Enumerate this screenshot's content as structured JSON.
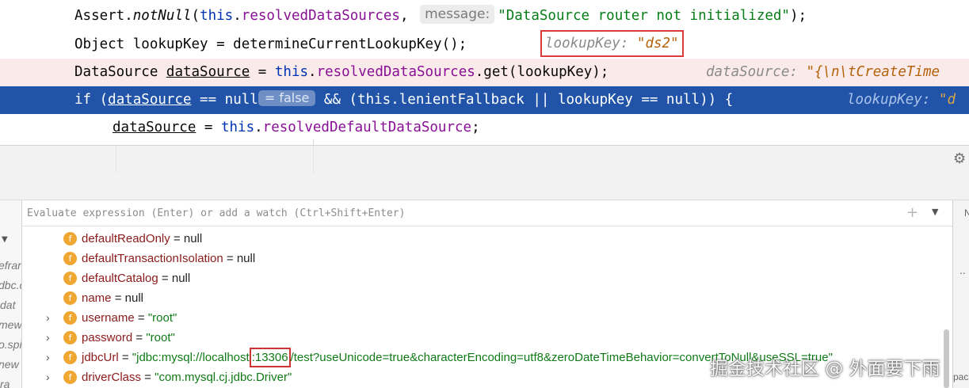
{
  "editor": {
    "line1": {
      "assert": "Assert.",
      "not_null": "notNull",
      "open": "(",
      "this_kw": "this",
      "dot": ".",
      "field": "resolvedDataSources",
      "comma": ",",
      "param_hint": "message:",
      "message": "\"DataSource router not initialized\"",
      "close": ");"
    },
    "line2": {
      "code": "Object lookupKey = determineCurrentLookupKey();",
      "inline_label": "lookupKey: ",
      "inline_value": "\"ds2\""
    },
    "line3": {
      "type": "DataSource ",
      "var": "dataSource",
      "eq": " = ",
      "this_kw": "this",
      "dot": ".",
      "field": "resolvedDataSources",
      "rest": ".get(lookupKey);",
      "inline_label": "dataSource: ",
      "inline_value": "\"{\\n\\tCreateTime"
    },
    "line4": {
      "if_kw": "if",
      "paren": " (",
      "var": "dataSource",
      "cond": " == null",
      "pill": "= false",
      "and": " && (",
      "this_kw": "this",
      "dot": ".",
      "field": "lenientFallback",
      "rest": " || lookupKey == null)) {",
      "inline_label": "lookupKey: ",
      "inline_value": "\"d"
    },
    "line5": {
      "var": "dataSource",
      "eq": " = ",
      "this_kw": "this",
      "dot": ".",
      "field": "resolvedDefaultDataSource",
      "end": ";"
    }
  },
  "watch": {
    "placeholder": "Evaluate expression (Enter) or add a watch (Ctrl+Shift+Enter)"
  },
  "frames": [
    "efran",
    "dbc.c",
    "dat",
    "mew",
    "o.spi",
    "new",
    "ra"
  ],
  "right_panel": {
    "label1": "N",
    "label2": "..",
    "label3": "pac"
  },
  "variables": [
    {
      "name": "defaultReadOnly",
      "eq": " = ",
      "value": "null",
      "is_string": false,
      "expandable": false
    },
    {
      "name": "defaultTransactionIsolation",
      "eq": " = ",
      "value": "null",
      "is_string": false,
      "expandable": false
    },
    {
      "name": "defaultCatalog",
      "eq": " = ",
      "value": "null",
      "is_string": false,
      "expandable": false
    },
    {
      "name": "name",
      "eq": " = ",
      "value": "null",
      "is_string": false,
      "expandable": false
    },
    {
      "name": "username",
      "eq": " = ",
      "value": "\"root\"",
      "is_string": true,
      "expandable": true
    },
    {
      "name": "password",
      "eq": " = ",
      "value": "\"root\"",
      "is_string": true,
      "expandable": true
    },
    {
      "name": "jdbcUrl",
      "eq": " = ",
      "value_prefix": "\"jdbc:mysql://localhost",
      "port": ":13306",
      "value_suffix": "/test?useUnicode=true&characterEncoding=utf8&zeroDateTimeBehavior=convertToNull&useSSL=true\"",
      "is_string": true,
      "expandable": true
    },
    {
      "name": "driverClass",
      "eq": " = ",
      "value": "\"com.mysql.cj.jdbc.Driver\"",
      "is_string": true,
      "expandable": true
    }
  ],
  "watermark": "掘金技术社区 @ 外面要下雨",
  "colors": {
    "current_line": "#2154a8",
    "breakpoint_line": "#fbeaea",
    "annotation_box": "#dc3b3b",
    "field_badge": "#f0a732",
    "string_value": "#117a17",
    "var_name": "#8b1a1a"
  },
  "icons": [
    "gear-icon",
    "add-watch-icon",
    "dropdown-icon",
    "expand-arrow-icon",
    "field-icon"
  ]
}
